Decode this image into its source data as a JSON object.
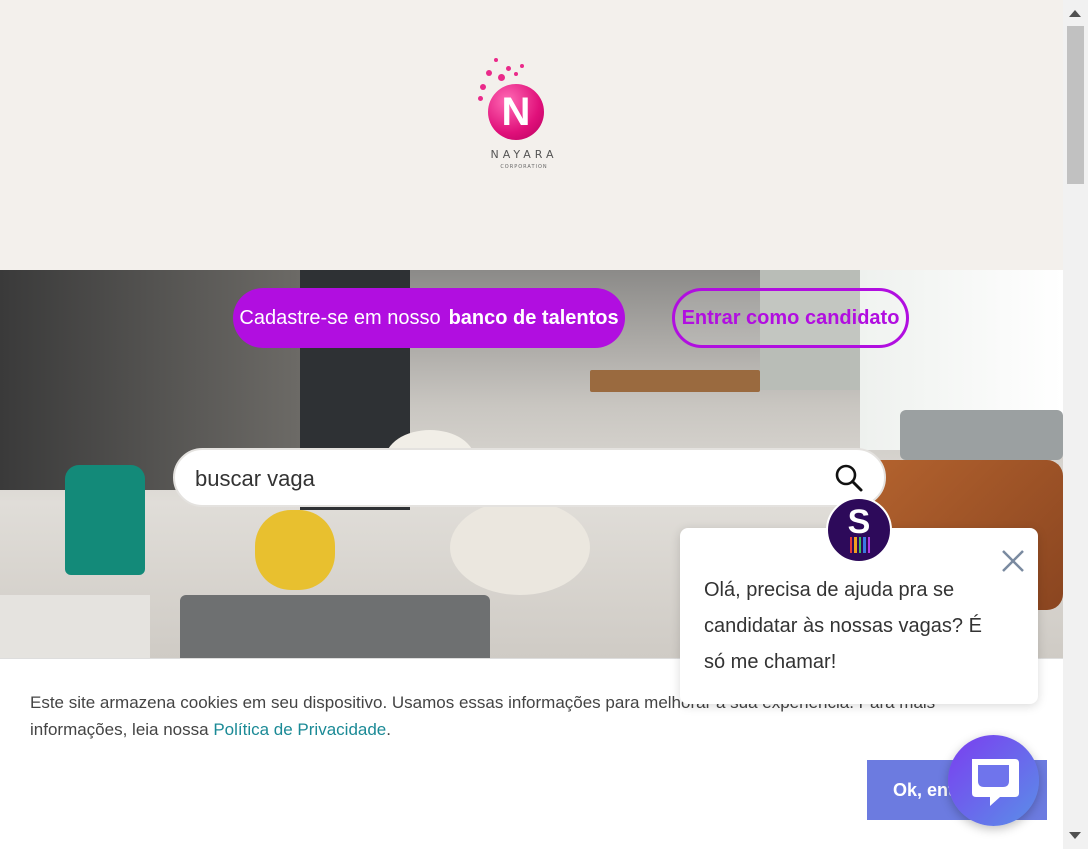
{
  "logo": {
    "name": "NAYARA",
    "sub": "CORPORATION",
    "letter": "N"
  },
  "hero": {
    "register_prefix": "Cadastre-se em nosso",
    "register_bold": "banco de talentos",
    "login_label": "Entrar como candidato",
    "search_placeholder": "buscar vaga"
  },
  "cookie": {
    "text": "Este site armazena cookies em seu dispositivo. Usamos essas informações para melhorar a sua experiência. Para mais informações, leia nossa ",
    "link": "Política de Privacidade",
    "suffix": ".",
    "button": "Ok, entendi"
  },
  "chat": {
    "message": "Olá, precisa de ajuda pra se candidatar às nossas vagas? É só me chamar!",
    "avatar_letter": "S"
  },
  "colors": {
    "accent": "#b10ee0",
    "cookie_button": "#6c7be0",
    "link": "#1b8a96",
    "logo_pink": "#e0107a"
  }
}
